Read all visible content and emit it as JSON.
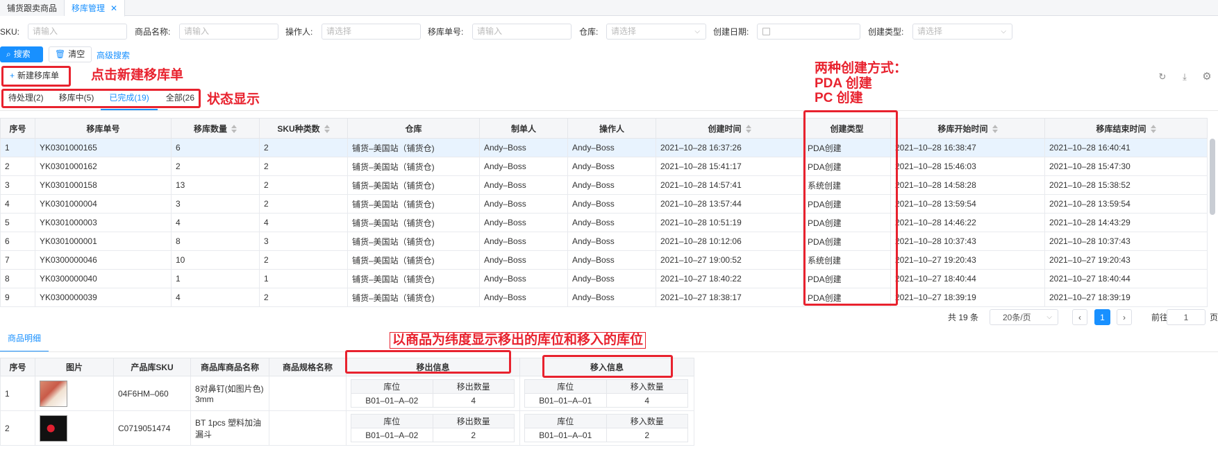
{
  "tabs": [
    {
      "label": "铺货跟卖商品"
    },
    {
      "label": "移库管理"
    }
  ],
  "filters": {
    "sku": {
      "label": "SKU:",
      "placeholder": "请输入"
    },
    "name": {
      "label": "商品名称:",
      "placeholder": "请输入"
    },
    "operator": {
      "label": "操作人:",
      "placeholder": "请选择"
    },
    "move_no": {
      "label": "移库单号:",
      "placeholder": "请输入"
    },
    "warehouse": {
      "label": "仓库:",
      "placeholder": "请选择"
    },
    "create_date": {
      "label": "创建日期:"
    },
    "create_type": {
      "label": "创建类型:",
      "placeholder": "请选择"
    }
  },
  "buttons": {
    "search": "搜索",
    "clear": "清空",
    "advanced": "高级搜索",
    "new_order": "新建移库单"
  },
  "status_tabs": [
    {
      "label": "待处理(2)"
    },
    {
      "label": "移库中(5)"
    },
    {
      "label": "已完成(19)"
    },
    {
      "label": "全部(26"
    }
  ],
  "annotations": {
    "click_new": "点击新建移库单",
    "status_show": "状态显示",
    "create_ways_title": "两种创建方式：",
    "create_ways_pda": "PDA 创建",
    "create_ways_pc": "PC 创建",
    "dimension": "以商品为纬度显示移出的库位和移入的库位"
  },
  "main_table": {
    "headers": [
      "序号",
      "移库单号",
      "移库数量",
      "SKU种类数",
      "仓库",
      "制单人",
      "操作人",
      "创建时间",
      "创建类型",
      "移库开始时间",
      "移库结束时间"
    ],
    "rows": [
      [
        "1",
        "YK0301000165",
        "6",
        "2",
        "铺货–美国站（铺货仓)",
        "Andy–Boss",
        "Andy–Boss",
        "2021–10–28 16:37:26",
        "PDA创建",
        "2021–10–28 16:38:47",
        "2021–10–28 16:40:41"
      ],
      [
        "2",
        "YK0301000162",
        "2",
        "2",
        "铺货–美国站（铺货仓)",
        "Andy–Boss",
        "Andy–Boss",
        "2021–10–28 15:41:17",
        "PDA创建",
        "2021–10–28 15:46:03",
        "2021–10–28 15:47:30"
      ],
      [
        "3",
        "YK0301000158",
        "13",
        "2",
        "铺货–美国站（铺货仓)",
        "Andy–Boss",
        "Andy–Boss",
        "2021–10–28 14:57:41",
        "系统创建",
        "2021–10–28 14:58:28",
        "2021–10–28 15:38:52"
      ],
      [
        "4",
        "YK0301000004",
        "3",
        "2",
        "铺货–美国站（铺货仓)",
        "Andy–Boss",
        "Andy–Boss",
        "2021–10–28 13:57:44",
        "PDA创建",
        "2021–10–28 13:59:54",
        "2021–10–28 13:59:54"
      ],
      [
        "5",
        "YK0301000003",
        "4",
        "4",
        "铺货–美国站（铺货仓)",
        "Andy–Boss",
        "Andy–Boss",
        "2021–10–28 10:51:19",
        "PDA创建",
        "2021–10–28 14:46:22",
        "2021–10–28 14:43:29"
      ],
      [
        "6",
        "YK0301000001",
        "8",
        "3",
        "铺货–美国站（铺货仓)",
        "Andy–Boss",
        "Andy–Boss",
        "2021–10–28 10:12:06",
        "PDA创建",
        "2021–10–28 10:37:43",
        "2021–10–28 10:37:43"
      ],
      [
        "7",
        "YK0300000046",
        "10",
        "2",
        "铺货–美国站（铺货仓)",
        "Andy–Boss",
        "Andy–Boss",
        "2021–10–27 19:00:52",
        "系统创建",
        "2021–10–27 19:20:43",
        "2021–10–27 19:20:43"
      ],
      [
        "8",
        "YK0300000040",
        "1",
        "1",
        "铺货–美国站（铺货仓)",
        "Andy–Boss",
        "Andy–Boss",
        "2021–10–27 18:40:22",
        "PDA创建",
        "2021–10–27 18:40:44",
        "2021–10–27 18:40:44"
      ],
      [
        "9",
        "YK0300000039",
        "4",
        "2",
        "铺货–美国站（铺货仓)",
        "Andy–Boss",
        "Andy–Boss",
        "2021–10–27 18:38:17",
        "PDA创建",
        "2021–10–27 18:39:19",
        "2021–10–27 18:39:19"
      ]
    ]
  },
  "pagination": {
    "total": "共 19 条",
    "page_size": "20条/页",
    "current": "1",
    "goto_label": "前往",
    "goto_value": "1",
    "page_suffix": "页"
  },
  "detail_tab": "商品明细",
  "detail_table": {
    "headers": [
      "序号",
      "图片",
      "产品库SKU",
      "商品库商品名称",
      "商品规格名称",
      "移出信息",
      "移入信息"
    ],
    "sub_headers": {
      "loc": "库位",
      "out_qty": "移出数量",
      "in_qty": "移入数量"
    },
    "rows": [
      {
        "no": "1",
        "sku": "04F6HM–060",
        "name": "8对鼻钉(如图片色) 3mm",
        "spec": "",
        "out_loc": "B01–01–A–02",
        "out_qty": "4",
        "in_loc": "B01–01–A–01",
        "in_qty": "4"
      },
      {
        "no": "2",
        "sku": "C0719051474",
        "name": "BT 1pcs 塑料加油漏斗",
        "spec": "",
        "out_loc": "B01–01–A–02",
        "out_qty": "2",
        "in_loc": "B01–01–A–01",
        "in_qty": "2"
      }
    ]
  }
}
